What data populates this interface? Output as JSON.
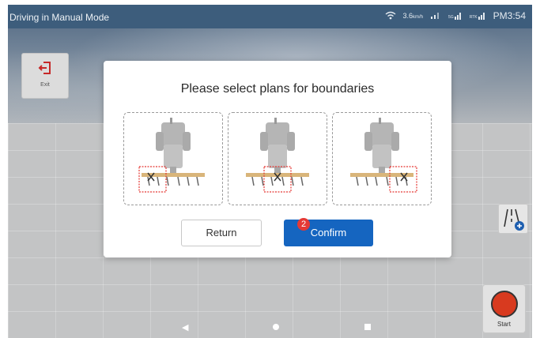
{
  "status_bar": {
    "title": "Driving in Manual Mode",
    "speed": "3.6",
    "speed_unit": "km/h",
    "sim_label": "5G",
    "rtk_label": "RTK",
    "time": "PM3:54"
  },
  "exit_button": {
    "label": "Exit"
  },
  "start_button": {
    "label": "Start"
  },
  "dialog": {
    "title": "Please select plans for boundaries",
    "options": [
      {
        "highlight": "left"
      },
      {
        "highlight": "center"
      },
      {
        "highlight": "right"
      }
    ],
    "return_label": "Return",
    "confirm_label": "Confirm",
    "confirm_badge": "2"
  },
  "colors": {
    "status_bar": "#3d5d7c",
    "primary": "#1565c0",
    "badge": "#e53935",
    "exit_icon": "#c62828",
    "highlight_box": "#e53935",
    "start": "#d83a1f"
  }
}
